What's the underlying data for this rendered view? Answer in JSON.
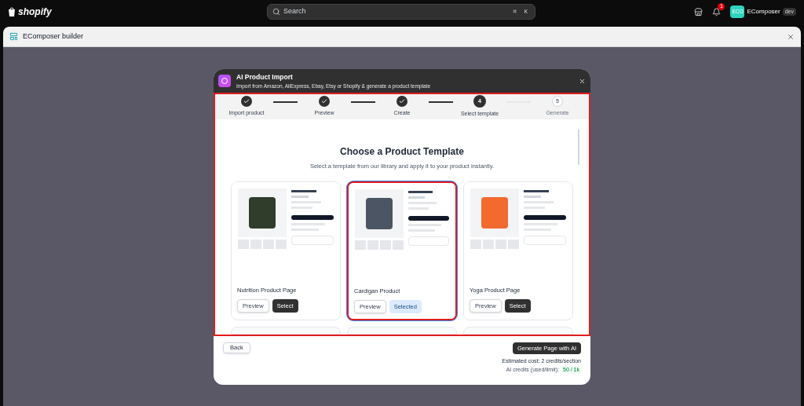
{
  "topbar": {
    "brand": "shopify",
    "search": {
      "placeholder": "Search"
    },
    "shortcut": [
      "⌘",
      "K"
    ],
    "notification_count": "1",
    "avatar": "ECO",
    "store": "EComposer",
    "badge": "dev"
  },
  "app_window": {
    "title": "EComposer builder"
  },
  "modal": {
    "title": "AI Product Import",
    "subtitle": "Import from Amazon, AliExpress, Ebay, Etsy or Shopify & generate a product template",
    "steps": [
      {
        "label": "Import product",
        "kind": "done"
      },
      {
        "label": "Preview",
        "kind": "done"
      },
      {
        "label": "Create",
        "kind": "done"
      },
      {
        "number": "4",
        "label": "Select template",
        "kind": "current"
      },
      {
        "number": "5",
        "label": "Generate",
        "kind": "upcoming"
      }
    ],
    "heading": "Choose a Product Template",
    "description": "Select a template from our library and apply it to your product instantly.",
    "templates": [
      {
        "name": "Nutrition Product Page",
        "preview": "Preview",
        "action": "Select",
        "selected": false
      },
      {
        "name": "Cardigan Product",
        "preview": "Preview",
        "action": "Selected",
        "selected": true
      },
      {
        "name": "Yoga Product Page",
        "preview": "Preview",
        "action": "Select",
        "selected": false
      }
    ],
    "back": "Back",
    "generate": "Generate Page with AI",
    "cost": "Estimated cost: 2 credits/section",
    "credits_label": "AI credits (used/limit):",
    "credits_value": "50 / 1k"
  }
}
